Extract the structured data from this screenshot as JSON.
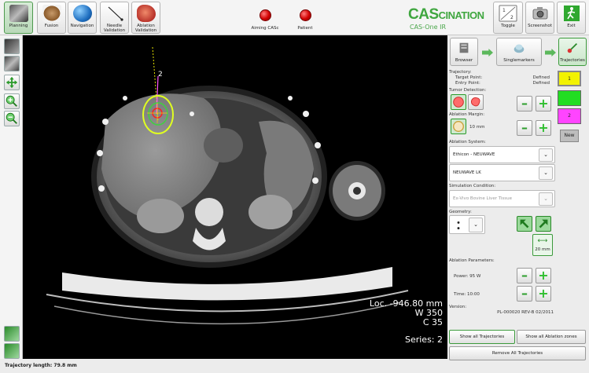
{
  "toolbar": {
    "buttons": [
      {
        "label": "Planning",
        "icon": "planning-icon",
        "active": true
      },
      {
        "label": "Fusion",
        "icon": "fusion-icon",
        "active": false
      },
      {
        "label": "Navigation",
        "icon": "globe-icon",
        "active": false
      },
      {
        "label": "Needle\nValidation",
        "icon": "needle-icon",
        "active": false
      },
      {
        "label": "Ablation\nValidation",
        "icon": "organ-icon",
        "active": false
      }
    ],
    "status": [
      {
        "label": "Aiming CASc",
        "color": "#d10000"
      },
      {
        "label": "Patient",
        "color": "#d10000"
      }
    ],
    "brand": {
      "strong": "CAS",
      "rest": "CINATION",
      "sub": "CAS-One IR"
    },
    "right_buttons": [
      {
        "label": "Toggle",
        "icon": "toggle-icon"
      },
      {
        "label": "Screenshot",
        "icon": "camera-icon"
      },
      {
        "label": "Exit",
        "icon": "exit-icon"
      }
    ]
  },
  "viewer": {
    "overlay": {
      "loc": "Loc. -946.80 mm",
      "w": "W 350",
      "c": "C 35",
      "series": "Series: 2"
    },
    "trajectory_marker": "2"
  },
  "footer": {
    "trajectory_length": "Trajectory length: 79.8 mm"
  },
  "workflow": {
    "browser": "Browser",
    "singlemarkers": "Singlemarkers",
    "trajectories": "Trajectories"
  },
  "panel": {
    "trajectory": {
      "title": "Trajectory:",
      "target_label": "Target Point:",
      "target_value": "Defined",
      "entry_label": "Entry Point:",
      "entry_value": "Defined"
    },
    "tumor_detection": "Tumor Detection:",
    "ablation_margin": {
      "title": "Ablation Margin:",
      "value": "10 mm"
    },
    "ablation_system": {
      "title": "Ablation System:",
      "system": "Ethicon - NEUWAVE",
      "probe": "NEUWAVE LK"
    },
    "simulation": {
      "title": "Simulation Condition:",
      "value": "Ex-Vivo Bovine Liver Tissue"
    },
    "geometry": {
      "title": "Geometry:",
      "spacing": "20 mm"
    },
    "ablation_params": {
      "title": "Ablation Parameters:",
      "power": "Power: 95 W",
      "time": "Time: 10:00"
    },
    "version": {
      "title": "Version:",
      "value": "PL-000020 REV-B 02/2011"
    },
    "show_all_trajectories": "Show all Trajectories",
    "show_all_ablation": "Show all Ablation zones",
    "remove_all": "Remove All Trajectories"
  },
  "trajectory_tabs": [
    {
      "label": "1",
      "color": "#f2f200"
    },
    {
      "label": "",
      "color": "#22dd22"
    },
    {
      "label": "2",
      "color": "#ff44ff"
    }
  ],
  "new_button": "New"
}
